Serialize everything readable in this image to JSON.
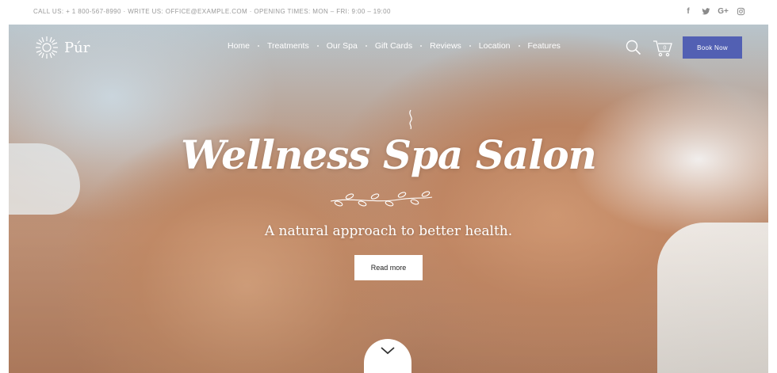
{
  "topbar": {
    "contact": "CALL US: + 1 800-567-8990 · WRITE US: OFFICE@EXAMPLE.COM · OPENING TIMES: MON – FRI: 9:00 – 19:00",
    "social": [
      "facebook-icon",
      "twitter-icon",
      "google-plus-icon",
      "instagram-icon"
    ]
  },
  "brand": {
    "name": "Púr"
  },
  "nav": [
    "Home",
    "Treatments",
    "Our Spa",
    "Gift Cards",
    "Reviews",
    "Location",
    "Features"
  ],
  "cart": {
    "count": "0"
  },
  "book_button": "Book Now",
  "hero": {
    "title": "Wellness Spa Salon",
    "tagline": "A natural approach to better health.",
    "cta": "Read more"
  },
  "colors": {
    "accent": "#5260b3",
    "text_light": "#ffffff"
  }
}
